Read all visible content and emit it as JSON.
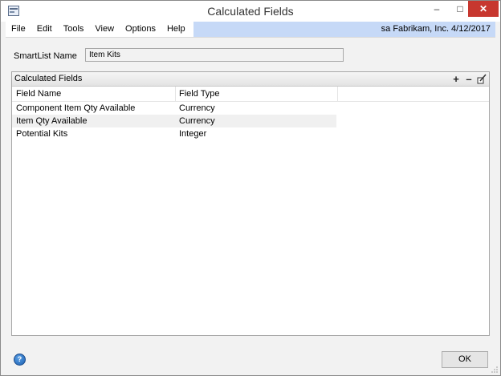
{
  "window": {
    "title": "Calculated Fields",
    "minimize": "–",
    "maximize": "□",
    "close": "✕"
  },
  "menu": {
    "items": [
      "File",
      "Edit",
      "Tools",
      "View",
      "Options",
      "Help"
    ],
    "status": "sa  Fabrikam, Inc.  4/12/2017"
  },
  "smartlist": {
    "label": "SmartList Name",
    "value": "Item Kits"
  },
  "panel": {
    "title": "Calculated Fields",
    "add": "+",
    "remove": "–",
    "columns": [
      "Field Name",
      "Field Type"
    ],
    "rows": [
      {
        "name": "Component Item Qty Available",
        "type": "Currency"
      },
      {
        "name": "Item Qty Available",
        "type": "Currency"
      },
      {
        "name": "Potential Kits",
        "type": "Integer"
      }
    ]
  },
  "footer": {
    "help": "?",
    "ok": "OK"
  },
  "icons": [
    "app-icon",
    "help-icon",
    "add-icon",
    "remove-icon",
    "edit-icon",
    "resize-grip-icon"
  ],
  "colors": {
    "status_bar": "#c6d9f7",
    "close_button": "#c7372f"
  }
}
